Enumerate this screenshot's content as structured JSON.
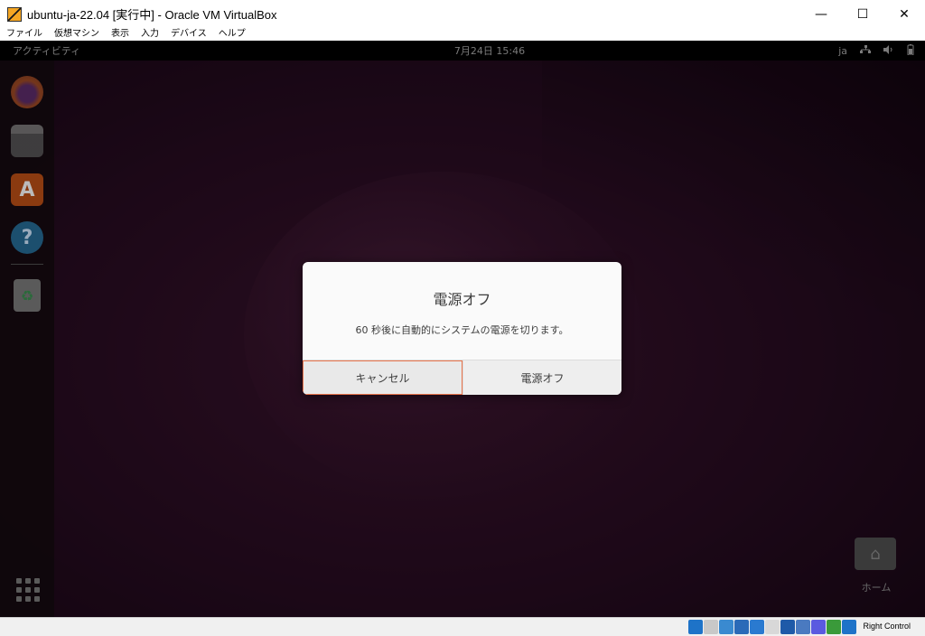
{
  "window": {
    "title": "ubuntu-ja-22.04 [実行中] - Oracle VM VirtualBox",
    "controls": {
      "minimize": "—",
      "maximize": "☐",
      "close": "✕"
    }
  },
  "menubar": [
    "ファイル",
    "仮想マシン",
    "表示",
    "入力",
    "デバイス",
    "ヘルプ"
  ],
  "gnome": {
    "activities": "アクティビティ",
    "clock": "7月24日  15:46",
    "input_method": "ja",
    "tray_icons": [
      "network-icon",
      "volume-icon",
      "power-icon"
    ]
  },
  "dock": {
    "apps": [
      "firefox-icon",
      "files-icon",
      "software-icon",
      "help-icon",
      "trash-icon",
      "app-grid-icon"
    ],
    "software_glyph": "A",
    "help_glyph": "?",
    "trash_glyph": "♻"
  },
  "desktop": {
    "home_label": "ホーム"
  },
  "dialog": {
    "title": "電源オフ",
    "message": "60 秒後に自動的にシステムの電源を切ります。",
    "cancel_label": "キャンセル",
    "power_off_label": "電源オフ"
  },
  "statusbar": {
    "host_key": "Right Control",
    "icon_colors": [
      "#1e73c8",
      "#c8c8c8",
      "#3a8ad0",
      "#2a6ab8",
      "#2a7ad0",
      "#d8d8d8",
      "#1e5aa8",
      "#4a7ac0",
      "#5a5ae0",
      "#3a9a3a",
      "#1e73c8"
    ]
  }
}
